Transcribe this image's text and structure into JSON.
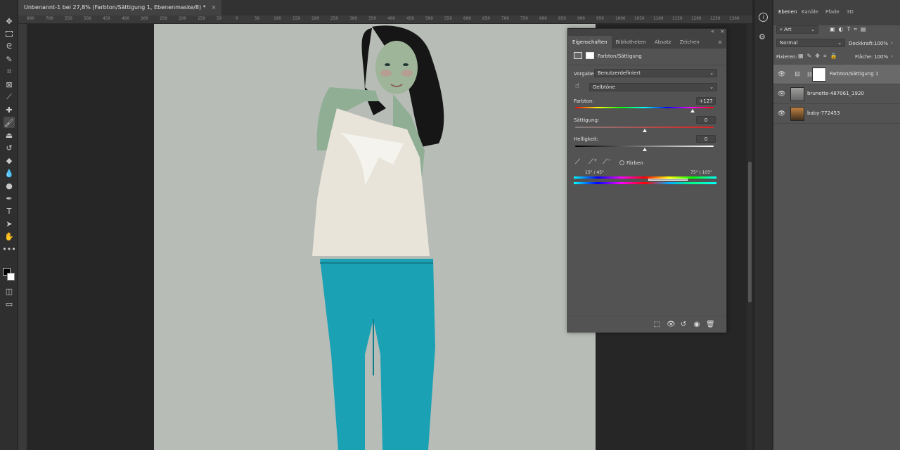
{
  "document": {
    "tab_title": "Unbenannt-1 bei 27,8% (Farbton/Sättigung 1, Ebenenmaske/8) *",
    "close_glyph": "×"
  },
  "ruler": {
    "ticks": [
      "900",
      "700",
      "550",
      "500",
      "450",
      "400",
      "300",
      "250",
      "200",
      "150",
      "50",
      "0",
      "50",
      "100",
      "150",
      "200",
      "250",
      "300",
      "350",
      "400",
      "450",
      "500",
      "550",
      "600",
      "650",
      "700",
      "750",
      "800",
      "850",
      "900",
      "950",
      "1000",
      "1050",
      "1100",
      "1150",
      "1200",
      "1250",
      "1300"
    ]
  },
  "toolbar": {
    "tools": [
      "move-icon",
      "marquee-icon",
      "lasso-icon",
      "quick-select-icon",
      "crop-icon",
      "frame-icon",
      "eyedropper-icon",
      "healing-icon",
      "brush-icon",
      "stamp-icon",
      "history-brush-icon",
      "eraser-icon",
      "paint-bucket-icon",
      "blur-icon",
      "dodge-icon",
      "pen-icon",
      "type-icon",
      "path-select-icon",
      "hand-icon",
      "more-icon"
    ]
  },
  "properties": {
    "tabs": [
      "Eigenschaften",
      "Bibliotheken",
      "Absatz",
      "Zeichen"
    ],
    "active_tab": "Eigenschaften",
    "adjustment_title": "Farbton/Sättigung",
    "preset_label": "Vorgabe:",
    "preset_value": "Benutzerdefiniert",
    "channel_value": "Gelbtöne",
    "hue_label": "Farbton:",
    "hue_value": "+127",
    "saturation_label": "Sättigung:",
    "saturation_value": "0",
    "lightness_label": "Helligkeit:",
    "lightness_value": "0",
    "colorize_label": "Färben",
    "range_left": "15° / 45°",
    "range_right": "75° \\ 105°",
    "hue_fraction": 0.85,
    "saturation_fraction": 0.5,
    "lightness_fraction": 0.5
  },
  "layers": {
    "tabs": [
      "Ebenen",
      "Kanäle",
      "Pfade",
      "3D"
    ],
    "active_tab": "Ebenen",
    "filter_label": "Art",
    "blend_mode": "Normal",
    "opacity_label": "Deckkraft:",
    "opacity_value": "100%",
    "lock_label": "Fixieren:",
    "fill_label": "Fläche:",
    "fill_value": "100%",
    "items": [
      {
        "name": "Farbton/Sättigung 1",
        "selected": true
      },
      {
        "name": "brunette-487061_1920",
        "selected": false
      },
      {
        "name": "baby-772453",
        "selected": false
      }
    ]
  },
  "colors": {
    "panel": "#535353",
    "dark": "#262626",
    "jeans": "#1aa2b4",
    "backdrop": "#b8bcb7"
  }
}
